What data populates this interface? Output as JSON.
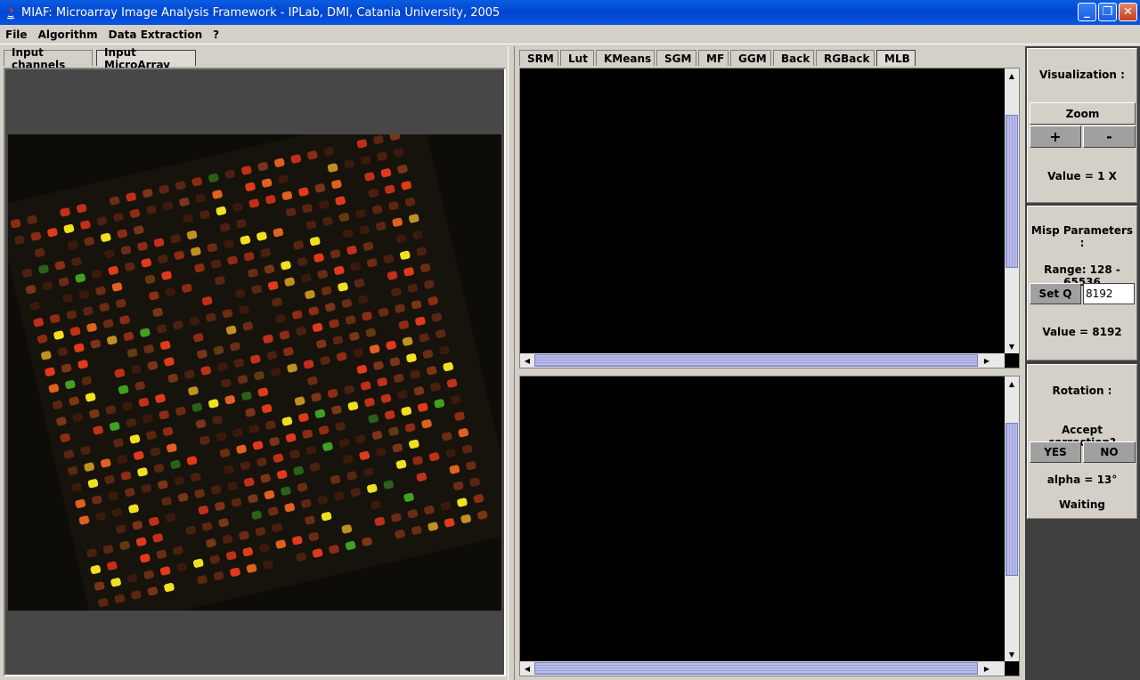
{
  "window": {
    "title": "MIAF: Microarray Image Analysis Framework  -  IPLab, DMI, Catania University, 2005"
  },
  "menu": [
    "File",
    "Algorithm",
    "Data Extraction",
    "?"
  ],
  "left_tabs": [
    "Input channels",
    "Input MicroArray"
  ],
  "algo_tabs": [
    "SRM",
    "Lut",
    "KMeans",
    "SGM",
    "MF",
    "GGM",
    "Back",
    "RGBack",
    "MLB"
  ],
  "visualization": {
    "title": "Visualization :",
    "zoom_label": "Zoom",
    "plus": "+",
    "minus": "-",
    "value": "Value = 1 X"
  },
  "misp": {
    "title": "Misp Parameters :",
    "range": "Range: 128 - 65536",
    "setq_label": "Set Q",
    "q_value": "8192",
    "value": "Value = 8192"
  },
  "rotation": {
    "title": "Rotation :",
    "accept": "Accept correction?",
    "yes": "YES",
    "no": "NO",
    "alpha": "alpha = 13°",
    "status": "Waiting"
  },
  "colors": {
    "titlebar": "#0045d0",
    "panel_bg": "#d4d0c8",
    "dark_bg": "#404040",
    "spot_red": "#e03a1a",
    "spot_yellow": "#f0e020",
    "spot_green": "#40c020"
  }
}
